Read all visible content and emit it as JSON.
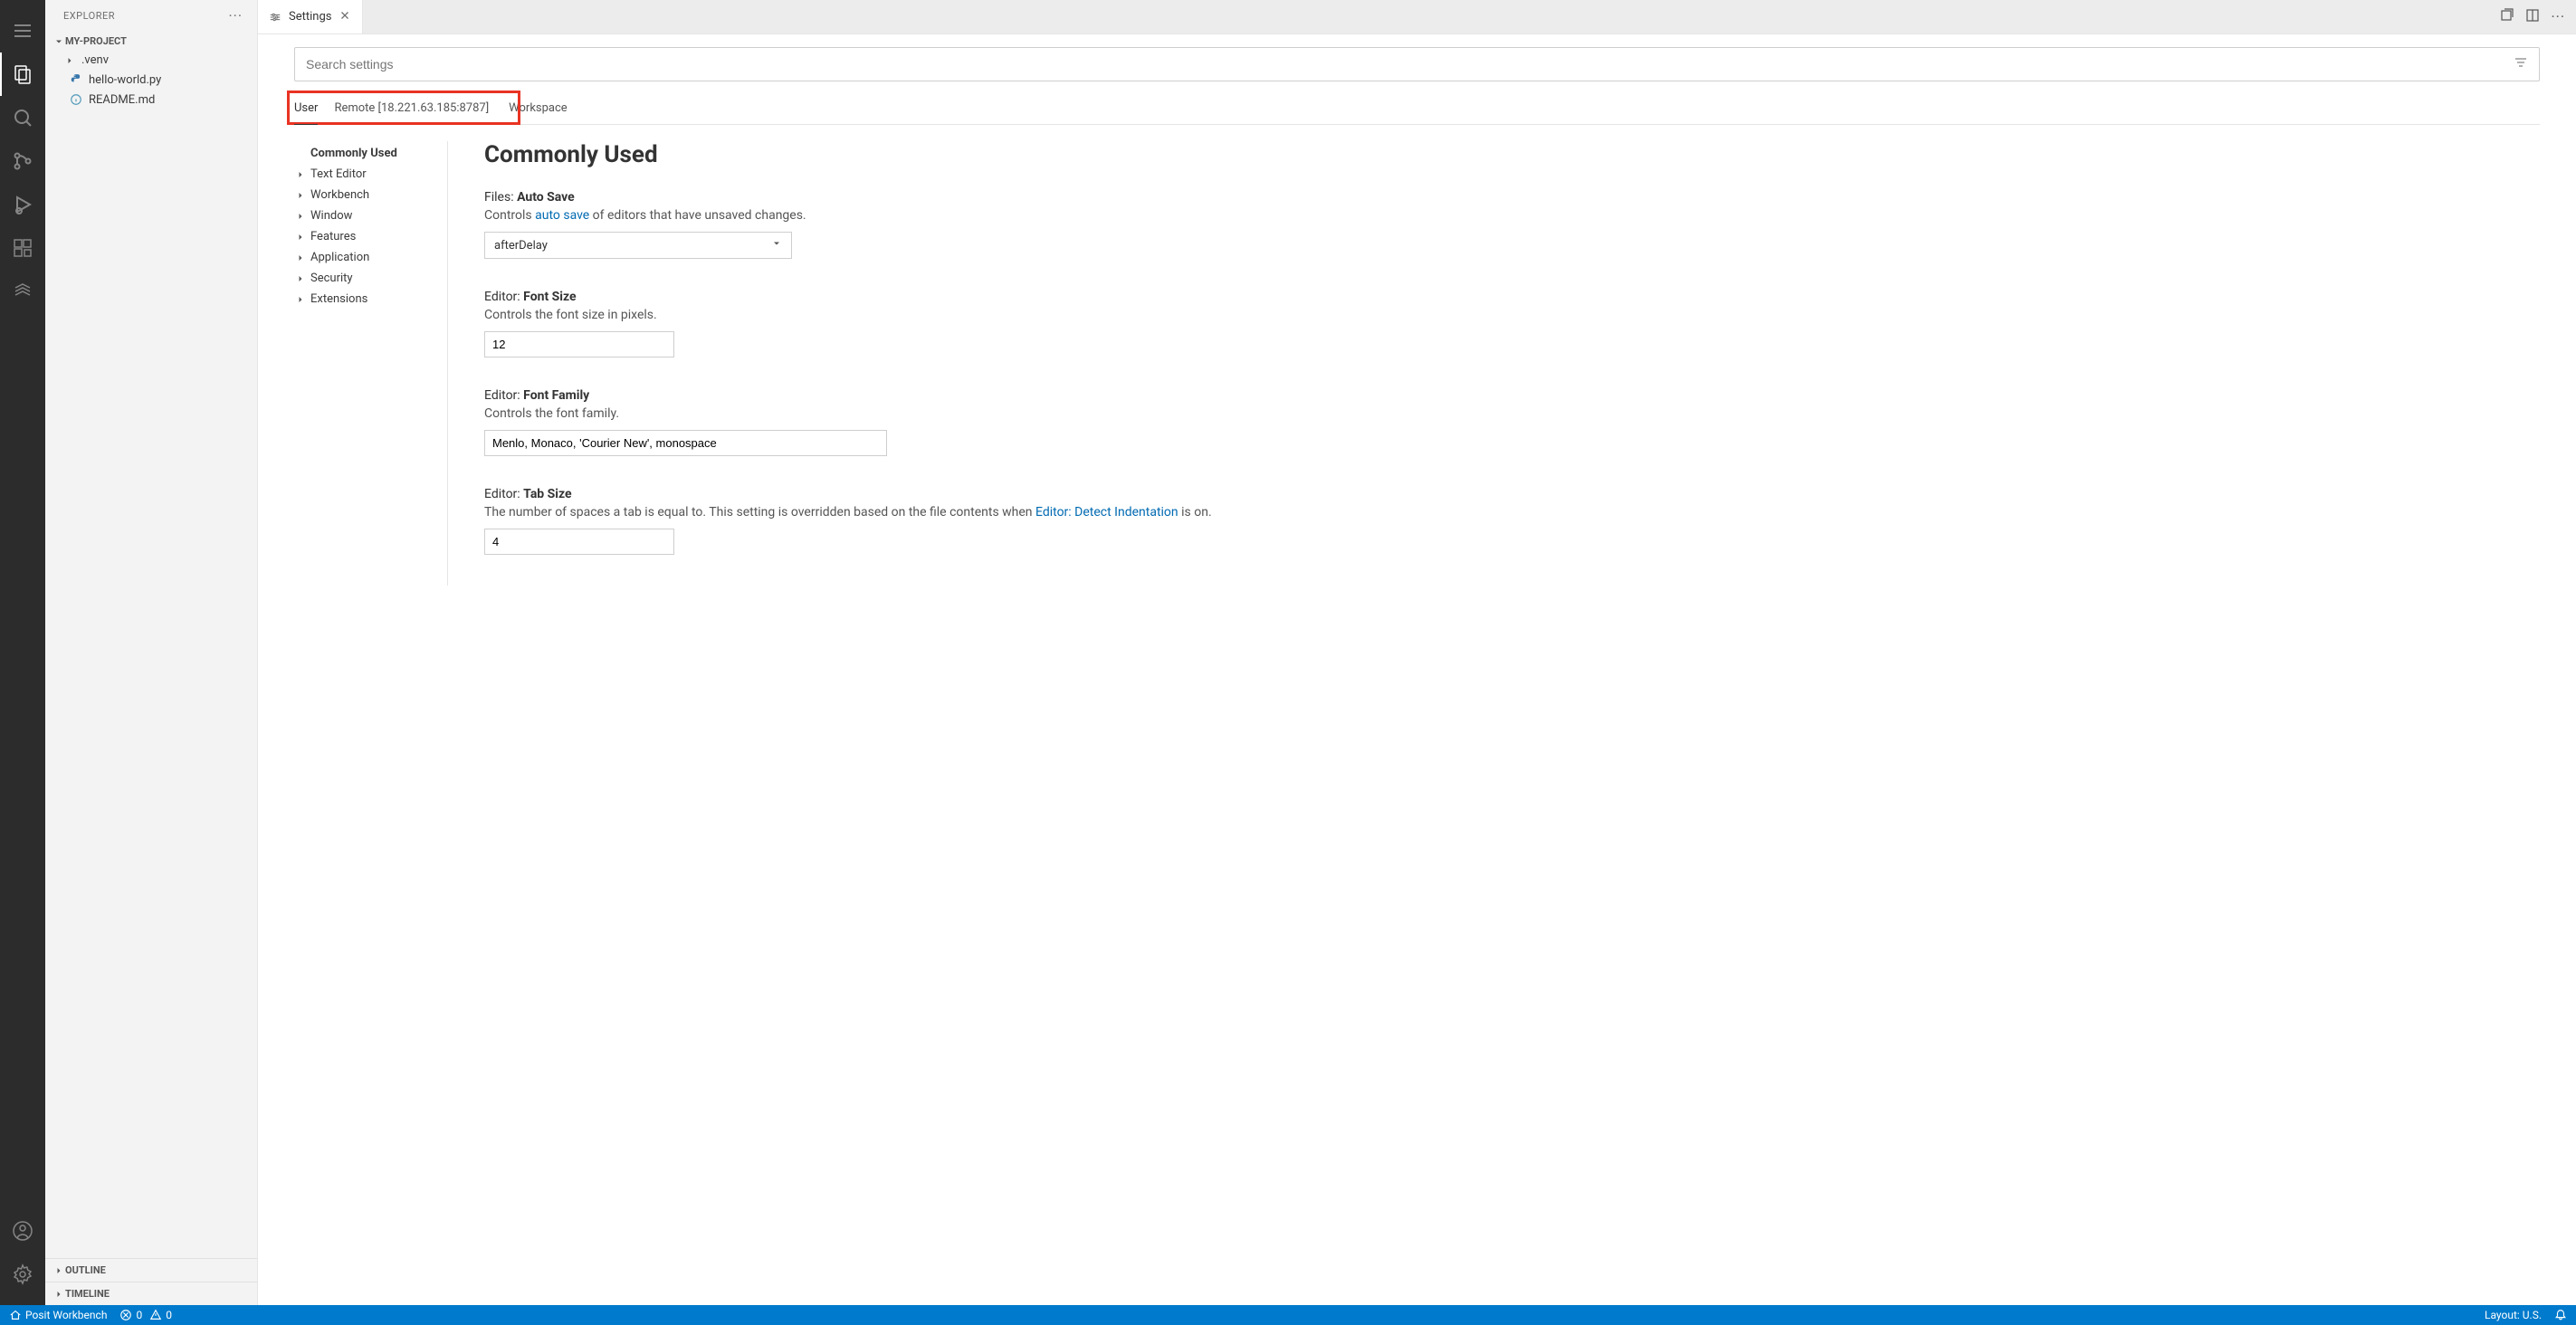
{
  "sidebar": {
    "title": "EXPLORER",
    "project": "MY-PROJECT",
    "items": [
      {
        "label": ".venv",
        "type": "folder"
      },
      {
        "label": "hello-world.py",
        "type": "python"
      },
      {
        "label": "README.md",
        "type": "markdown"
      }
    ],
    "outline": "OUTLINE",
    "timeline": "TIMELINE"
  },
  "tab": {
    "label": "Settings"
  },
  "settings": {
    "search_placeholder": "Search settings",
    "scopes": {
      "user": "User",
      "remote": "Remote [18.221.63.185:8787]",
      "workspace": "Workspace"
    },
    "nav": [
      "Commonly Used",
      "Text Editor",
      "Workbench",
      "Window",
      "Features",
      "Application",
      "Security",
      "Extensions"
    ],
    "heading": "Commonly Used",
    "autosave": {
      "prefix": "Files: ",
      "name": "Auto Save",
      "desc_before": "Controls ",
      "desc_link": "auto save",
      "desc_after": " of editors that have unsaved changes.",
      "value": "afterDelay"
    },
    "fontsize": {
      "prefix": "Editor: ",
      "name": "Font Size",
      "desc": "Controls the font size in pixels.",
      "value": "12"
    },
    "fontfamily": {
      "prefix": "Editor: ",
      "name": "Font Family",
      "desc": "Controls the font family.",
      "value": "Menlo, Monaco, 'Courier New', monospace"
    },
    "tabsize": {
      "prefix": "Editor: ",
      "name": "Tab Size",
      "desc_before": "The number of spaces a tab is equal to. This setting is overridden based on the file contents when ",
      "desc_link": "Editor: Detect Indentation",
      "desc_after": " is on.",
      "value": "4"
    }
  },
  "statusbar": {
    "workbench": "Posit Workbench",
    "errors": "0",
    "warnings": "0",
    "layout": "Layout: U.S."
  }
}
